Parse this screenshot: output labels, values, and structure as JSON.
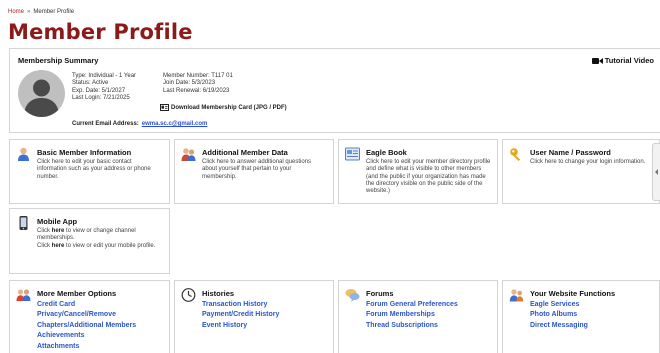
{
  "breadcrumb": {
    "home": "Home",
    "separator": "»",
    "current": "Member Profile"
  },
  "page_title": "Member Profile",
  "summary": {
    "title": "Membership Summary",
    "tutorial_label": "Tutorial Video",
    "type": "Type: Individual - 1 Year",
    "status": "Status: Active",
    "exp_date": "Exp. Date: 5/1/2027",
    "last_login": "Last Login: 7/21/2025",
    "member_number": "Member Number: T117 01",
    "join_date": "Join Date: 5/3/2023",
    "last_renewal": "Last Renewal: 6/19/2023",
    "download_card": "Download Membership Card (JPG / PDF)",
    "email_label": "Current Email Address:",
    "email_value": "ewma.sc.c@gmail.com"
  },
  "cards": {
    "basic": {
      "title": "Basic Member Information",
      "desc": "Click here to edit your basic contact information such as your address or phone number."
    },
    "additional": {
      "title": "Additional Member Data",
      "desc": "Click here to answer additional questions about yourself that pertain to your membership."
    },
    "eagle": {
      "title": "Eagle Book",
      "desc": "Click here to edit your member directory profile and define what is visible to other members (and the public if your organization has made the directory visible on the public side of the website.)"
    },
    "username": {
      "title": "User Name / Password",
      "desc": "Click here to change your login information."
    },
    "mobile": {
      "title": "Mobile App",
      "line1_pre": "Click ",
      "line1_link": "here",
      "line1_post": " to view or change channel memberships.",
      "line2_pre": "Click ",
      "line2_link": "here",
      "line2_post": " to view or edit your mobile profile."
    }
  },
  "sections": {
    "more": {
      "title": "More Member Options",
      "links": [
        "Credit Card",
        "Privacy/Cancel/Remove",
        "Chapters/Additional Members",
        "Achievements",
        "Attachments"
      ]
    },
    "histories": {
      "title": "Histories",
      "links": [
        "Transaction History",
        "Payment/Credit History",
        "Event History"
      ]
    },
    "forums": {
      "title": "Forums",
      "links": [
        "Forum General Preferences",
        "Forum Memberships",
        "Thread Subscriptions"
      ]
    },
    "website": {
      "title": "Your Website Functions",
      "links": [
        "Eagle Services",
        "Photo Albums",
        "Direct Messaging"
      ]
    }
  },
  "icons": {
    "tutorial": "video-camera-icon",
    "card": "id-card-icon",
    "basic": "person-icon",
    "additional": "people-icon",
    "eagle": "book-icon",
    "username": "key-icon",
    "mobile": "phone-icon",
    "more": "users-group-icon",
    "histories": "clock-icon",
    "forums": "chat-bubbles-icon",
    "website": "users-web-icon"
  },
  "colors": {
    "title": "#8b1a1a",
    "link": "#2b56c8"
  }
}
